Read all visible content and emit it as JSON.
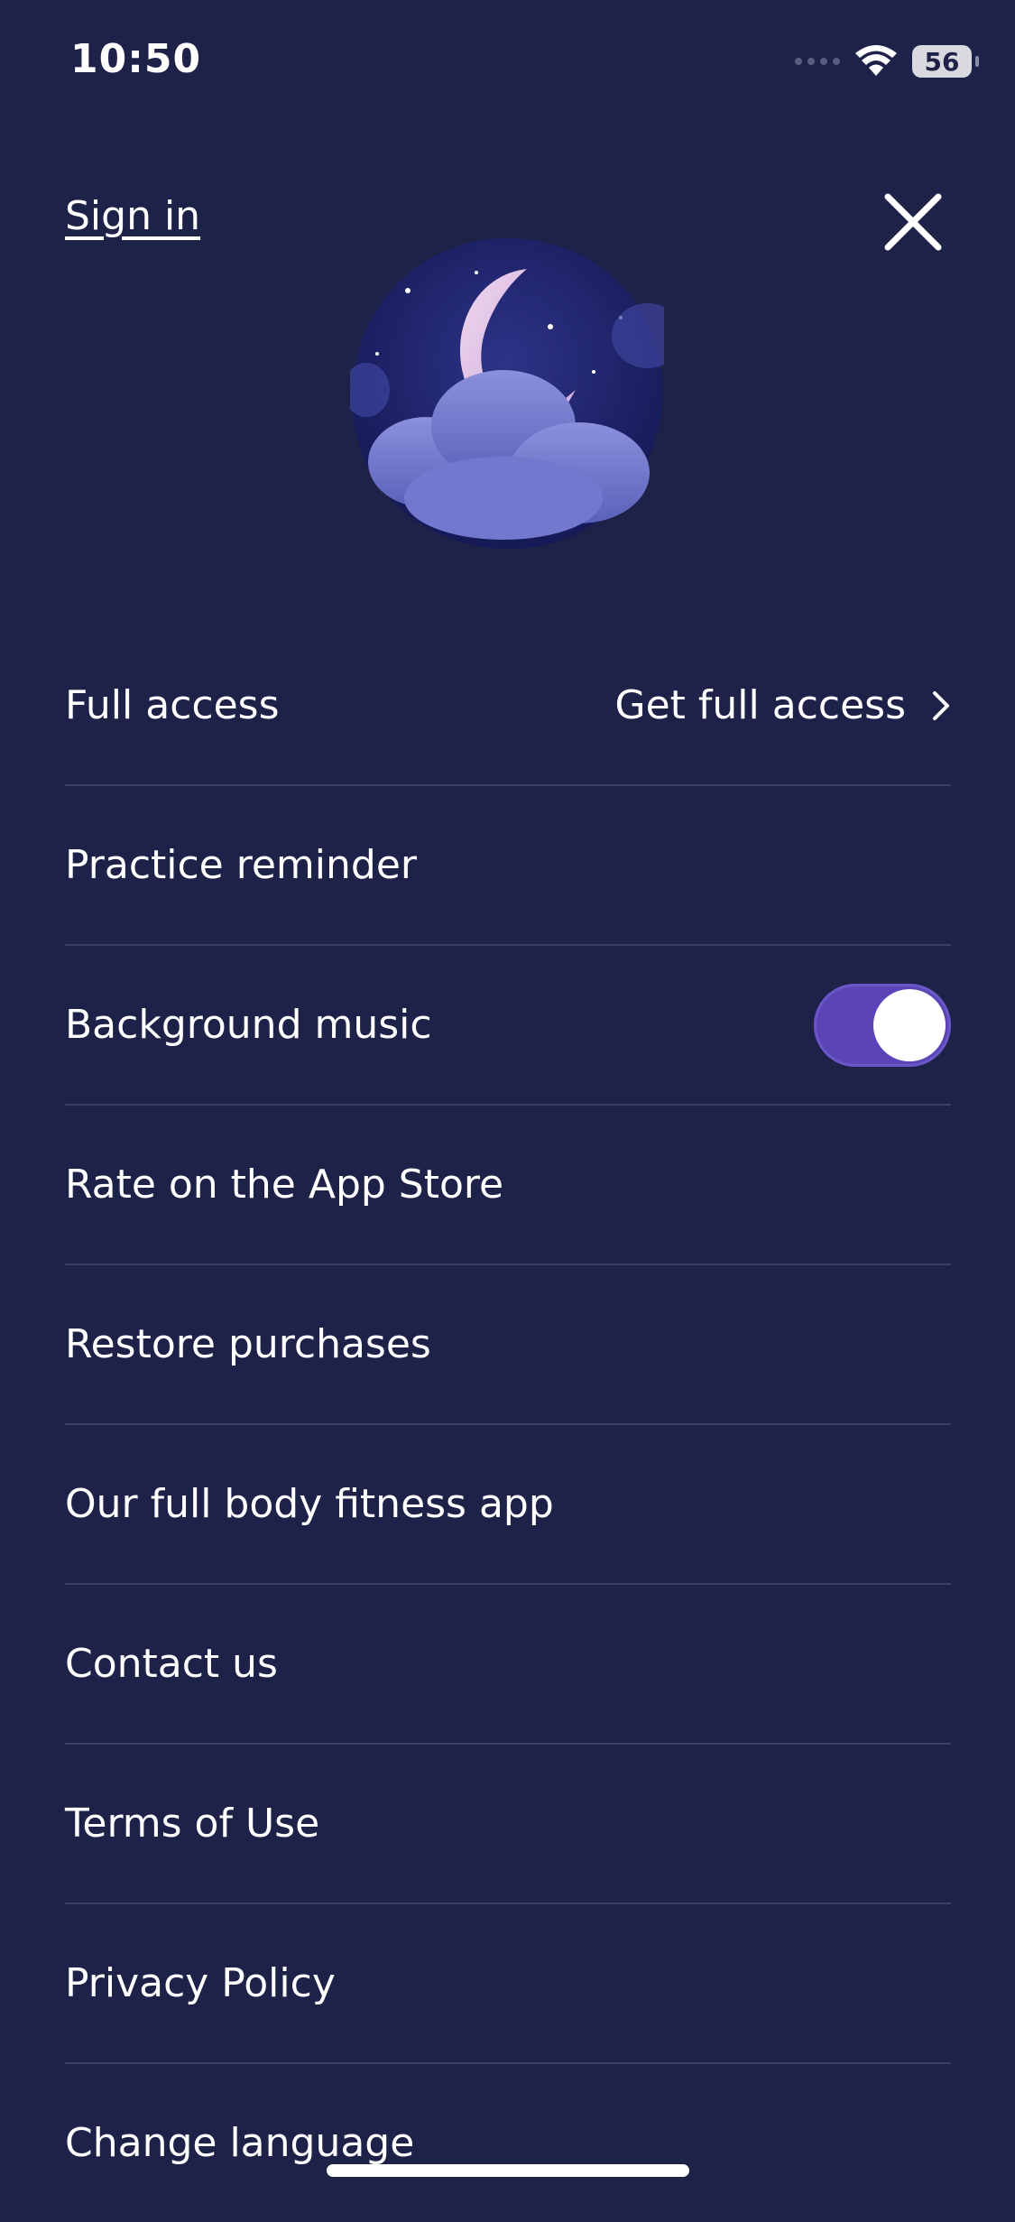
{
  "status_bar": {
    "time": "10:50",
    "battery": "56",
    "icons": [
      "signal-icon",
      "wifi-icon",
      "battery-icon"
    ]
  },
  "header": {
    "sign_in_label": "Sign in",
    "close_icon": "close-icon"
  },
  "avatar": {
    "icon": "moon-cloud-illustration"
  },
  "settings": {
    "full_access": {
      "label": "Full access",
      "value": "Get full access"
    },
    "practice_reminder": {
      "label": "Practice reminder"
    },
    "background_music": {
      "label": "Background music",
      "enabled": true
    },
    "rate": {
      "label": "Rate on the App Store"
    },
    "restore": {
      "label": "Restore purchases"
    },
    "fitness": {
      "label": "Our full body fitness app"
    },
    "contact": {
      "label": "Contact us"
    },
    "terms": {
      "label": "Terms of Use"
    },
    "privacy": {
      "label": "Privacy Policy"
    },
    "language": {
      "label": "Change language"
    }
  },
  "colors": {
    "background": "#1e2148",
    "divider": "#3b3e66",
    "toggle_on": "#5b44b6",
    "text": "#ffffff"
  }
}
